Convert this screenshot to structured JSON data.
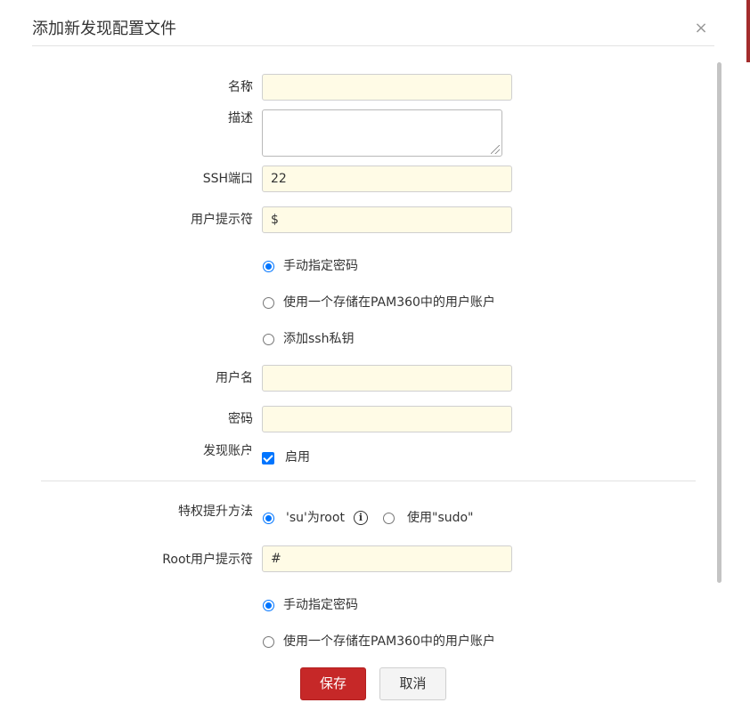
{
  "dialog": {
    "title": "添加新发现配置文件",
    "close_glyph": "×"
  },
  "form": {
    "colon": ":",
    "name": {
      "label": "名称",
      "value": ""
    },
    "description": {
      "label": "描述",
      "value": ""
    },
    "ssh_port": {
      "label": "SSH端口",
      "value": "22"
    },
    "user_prompt": {
      "label": "用户提示符",
      "value": "$"
    },
    "credential_options": [
      {
        "label": "手动指定密码",
        "selected": true
      },
      {
        "label": "使用一个存储在PAM360中的用户账户",
        "selected": false
      },
      {
        "label": "添加ssh私钥",
        "selected": false
      }
    ],
    "username": {
      "label": "用户名",
      "value": ""
    },
    "password": {
      "label": "密码",
      "value": ""
    },
    "discover_accounts": {
      "label": "发现账户",
      "checkbox_label": "启用",
      "checked": true
    },
    "privilege_method": {
      "label": "特权提升方法",
      "options": [
        {
          "label": "'su'为root",
          "selected": true
        },
        {
          "label": "使用\"sudo\"",
          "selected": false
        }
      ],
      "info_glyph": "i"
    },
    "root_prompt": {
      "label": "Root用户提示符",
      "value": "#"
    },
    "root_credential_options": [
      {
        "label": "手动指定密码",
        "selected": true
      },
      {
        "label": "使用一个存储在PAM360中的用户账户",
        "selected": false
      }
    ]
  },
  "buttons": {
    "save": "保存",
    "cancel": "取消"
  },
  "colors": {
    "accent": "#c62828",
    "input_bg": "#fffbe6",
    "radio_selected": "#0075ff"
  }
}
